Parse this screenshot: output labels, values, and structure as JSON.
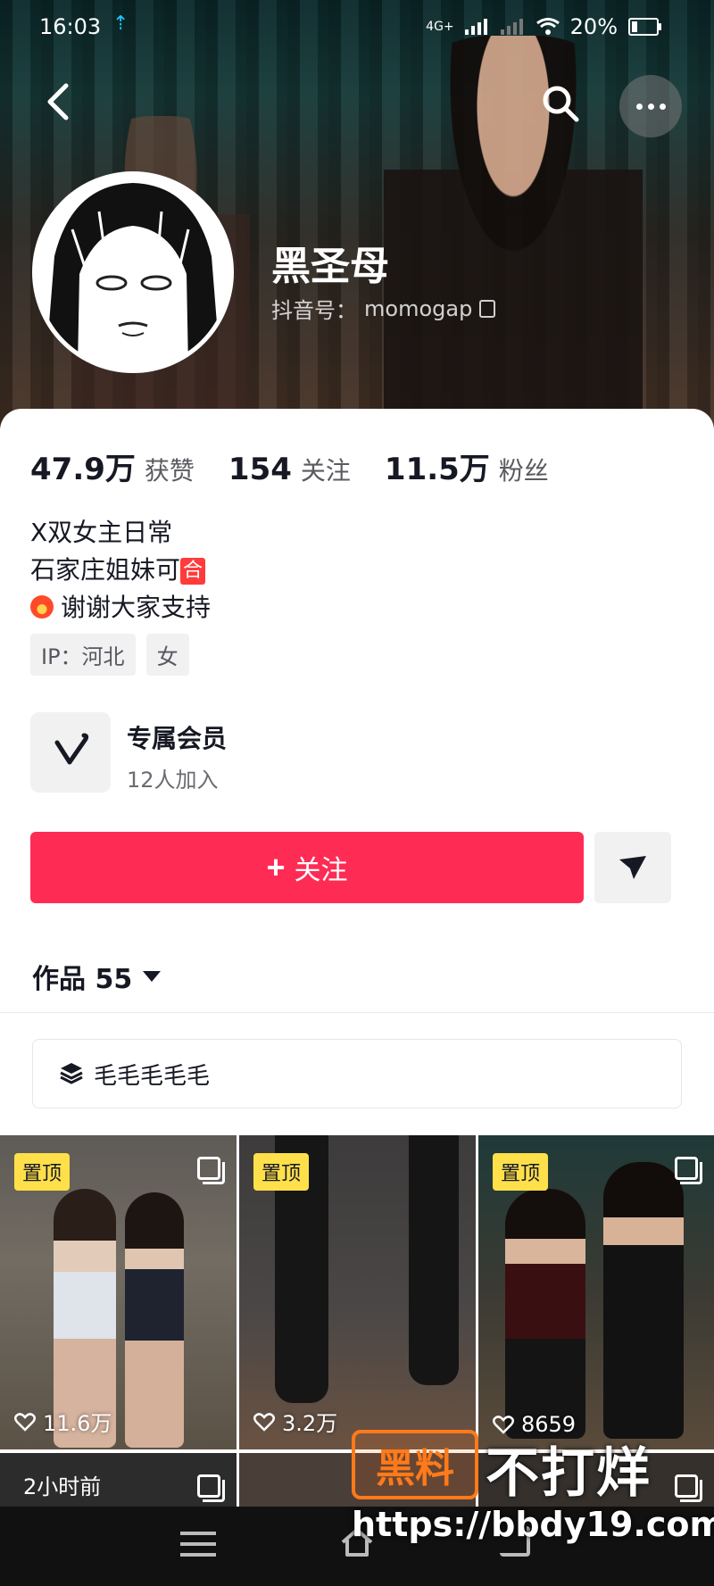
{
  "status_bar": {
    "time": "16:03",
    "network": "4G+",
    "battery": "20%"
  },
  "profile": {
    "name": "黑圣母",
    "handle_label": "抖音号：",
    "handle": "momogap"
  },
  "stats": [
    {
      "value": "47.9万",
      "label": "获赞"
    },
    {
      "value": "154",
      "label": "关注"
    },
    {
      "value": "11.5万",
      "label": "粉丝"
    }
  ],
  "bio": {
    "line1": "X双女主日常",
    "line2_text": "石家庄姐妹可",
    "line2_badge": "合",
    "line3": "谢谢大家支持"
  },
  "tags": [
    "IP：河北",
    "女"
  ],
  "membership": {
    "title": "专属会员",
    "subtitle": "12人加入"
  },
  "actions": {
    "follow_label": "关注"
  },
  "works": {
    "label": "作品 55"
  },
  "collection": {
    "label": "毛毛毛毛毛"
  },
  "grid": {
    "pinned_label": "置顶",
    "items": [
      {
        "likes": "11.6万"
      },
      {
        "likes": "3.2万"
      },
      {
        "likes": "8659"
      }
    ],
    "row2_time": "2小时前"
  },
  "watermark": {
    "logo": "黑料",
    "text": "不打烊",
    "url": "https://bbdy19.com"
  },
  "colors": {
    "accent": "#fe2c55",
    "pin": "#ffe04a",
    "watermark": "#ff7a1a"
  }
}
